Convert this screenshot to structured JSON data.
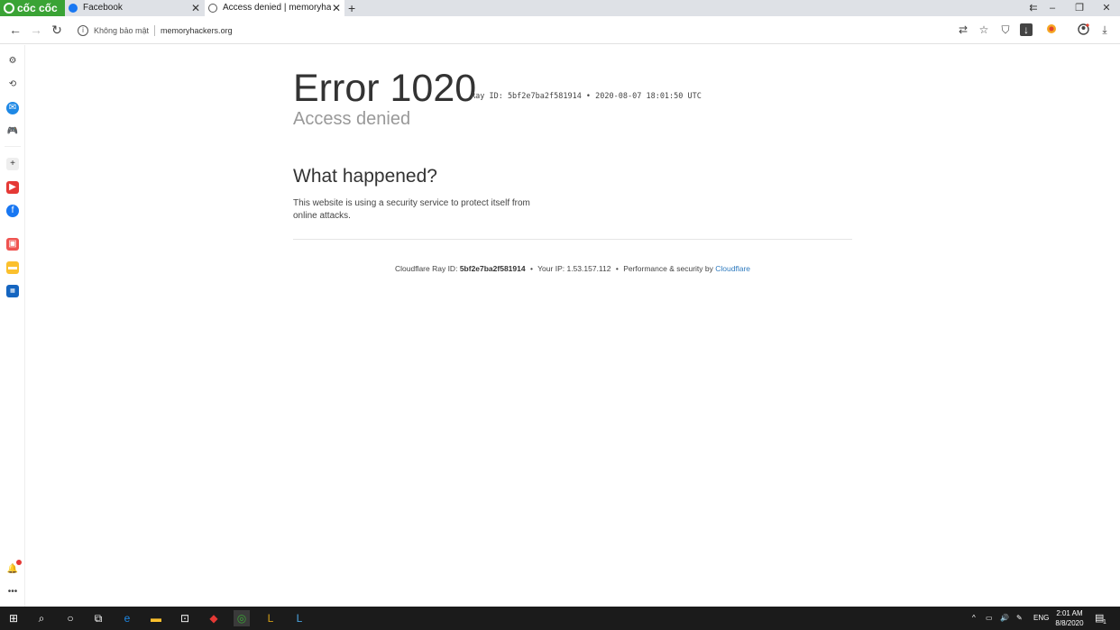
{
  "browser": {
    "brand": "cốc cốc",
    "tabs": [
      {
        "label": "Facebook",
        "icon": "facebook-icon"
      },
      {
        "label": "Access denied | memoryhack",
        "icon": "globe-icon"
      }
    ],
    "address": {
      "security_label": "Không bảo mật",
      "url": "memoryhackers.org"
    }
  },
  "page": {
    "error_title": "Error 1020",
    "ray_line": "Ray ID: 5bf2e7ba2f581914 • 2020-08-07 18:01:50 UTC",
    "subtitle": "Access denied",
    "heading": "What happened?",
    "description": "This website is using a security service to protect itself from online attacks.",
    "footer": {
      "ray_prefix": "Cloudflare Ray ID:",
      "ray_id": "5bf2e7ba2f581914",
      "ip_label": "Your IP: 1.53.157.112",
      "perf_label": "Performance & security by",
      "cloudflare_link": "Cloudflare",
      "bullet": "•"
    }
  },
  "taskbar": {
    "language": "ENG",
    "time": "2:01 AM",
    "date": "8/8/2020",
    "notification_count": "1"
  },
  "colors": {
    "brand_green": "#3aa335",
    "link_blue": "#2f7bbf",
    "taskbar_bg": "#1b1b1b"
  }
}
